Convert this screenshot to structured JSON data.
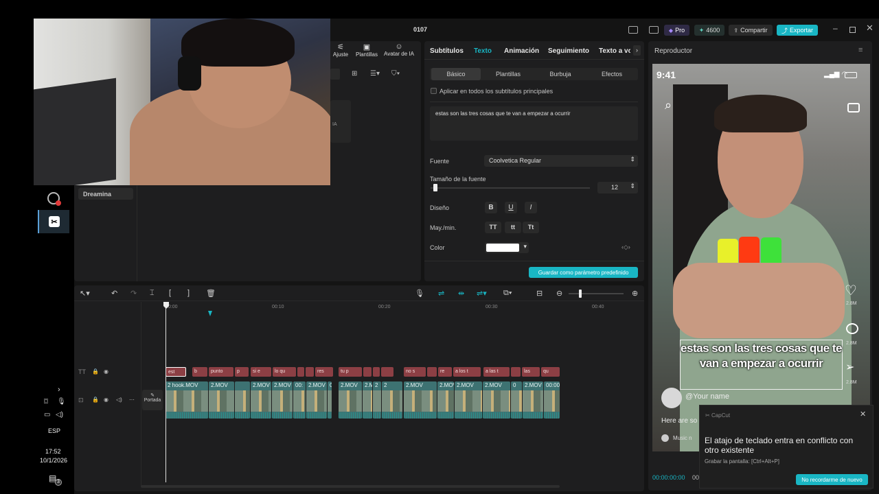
{
  "window": {
    "title": "0107"
  },
  "titlebar": {
    "pro_label": "Pro",
    "credits": "4600",
    "share_label": "Compartir",
    "export_label": "Exportar"
  },
  "left_toolbar": {
    "items": [
      {
        "label": "Ajuste"
      },
      {
        "label": "Plantillas"
      },
      {
        "label": "Avatar de IA"
      }
    ],
    "sidebar_item": "Dreamina",
    "partial_card_text": "IA"
  },
  "inspector": {
    "tabs": [
      "Subtítulos",
      "Texto",
      "Animación",
      "Seguimiento",
      "Texto a vo"
    ],
    "active_tab": "Texto",
    "subtabs": [
      "Básico",
      "Plantillas",
      "Burbuja",
      "Efectos"
    ],
    "apply_all_label": "Aplicar en todos los subtítulos principales",
    "text_content": "estas son las tres cosas que te van a empezar a ocurrir",
    "font_label": "Fuente",
    "font_value": "Coolvetica Regular",
    "font_size_label": "Tamaño de la fuente",
    "font_size_value": "12",
    "design_label": "Diseño",
    "design_buttons": [
      "B",
      "U",
      "I"
    ],
    "case_label": "May./min.",
    "case_buttons": [
      "TT",
      "tt",
      "Tt"
    ],
    "color_label": "Color",
    "save_preset_label": "Guardar como parámetro predefinido"
  },
  "player": {
    "title": "Reproductor",
    "phone_time": "9:41",
    "caption": "estas son las tres cosas que te van a empezar a ocurrir",
    "username_placeholder": "@Your name",
    "desc_text": "Here are so",
    "music_text": "Music n",
    "likes": [
      "2.8M",
      "2.8M",
      "2.8M"
    ],
    "timecode": "00:00:00:00",
    "timecode_partial": "00"
  },
  "timeline": {
    "ruler": [
      "00:00",
      "00:10",
      "00:20",
      "00:30",
      "00:40"
    ],
    "cover_label": "Portada",
    "text_clips": [
      "est",
      "b",
      "punto",
      "p",
      "si e",
      "lo qu",
      "",
      "",
      "res",
      "tu p",
      "",
      "",
      "",
      "no s",
      "",
      "re",
      "a los t",
      "a las t",
      "",
      "las",
      "qu"
    ],
    "video_clips": [
      "2 hook.MOV",
      "2.MOV",
      "2.MOV",
      "2.MOV",
      "00:",
      "2.MOV",
      "0",
      "2.MOV",
      "2.M",
      "2",
      "2",
      "2.MOV",
      "2.MOV",
      "2.MOV",
      "2.MOV",
      "0",
      "2.MOV",
      "00:00"
    ]
  },
  "toast": {
    "app_name": "CapCut",
    "title": "El atajo de teclado entra en conflicto con otro existente",
    "subtitle": "Grabar la pantalla: [Ctrl+Alt+P]",
    "dismiss_label": "No recordarme de nuevo"
  },
  "system_tray": {
    "language": "ESP",
    "time": "17:52",
    "date": "10/1/2026",
    "notification_count": "3"
  },
  "colors": {
    "accent": "#19b6c4",
    "text_clip": "#8c3f44",
    "video_clip": "#3d7272"
  }
}
